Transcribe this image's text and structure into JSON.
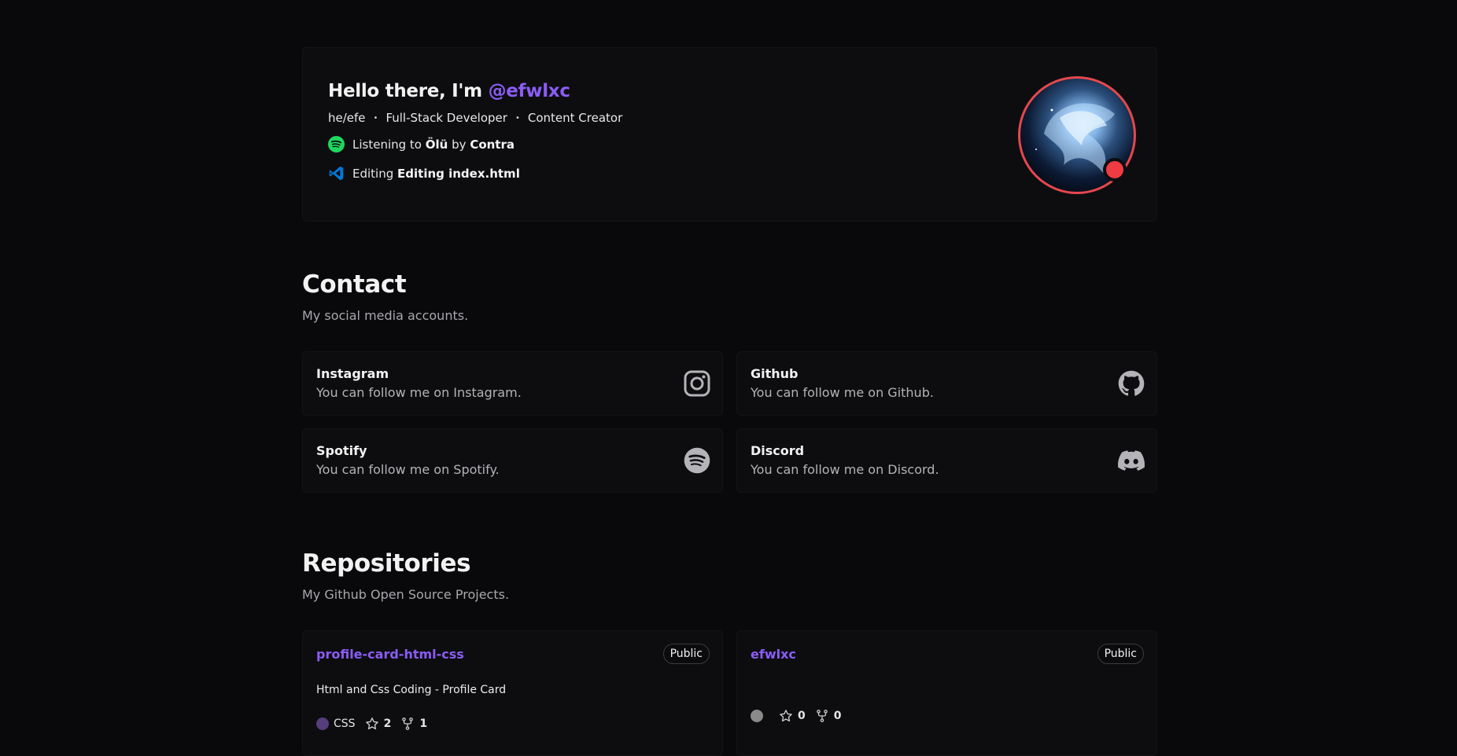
{
  "hero": {
    "greeting": "Hello there, I'm ",
    "handle": "@efwlxc",
    "pronouns": "he/efe",
    "separator": "•",
    "roles": [
      "Full-Stack Developer",
      "Content Creator"
    ],
    "spotify": {
      "prefix": "Listening to",
      "song": "Ölü",
      "by": "by",
      "artist": "Contra"
    },
    "editor": {
      "prefix": "Editing",
      "file": "Editing index.html"
    },
    "status_color": "#ef3b42"
  },
  "contact": {
    "title": "Contact",
    "description": "My social media accounts.",
    "cards": [
      {
        "title": "Instagram",
        "desc": "You can follow me on Instagram.",
        "icon": "instagram-icon"
      },
      {
        "title": "Github",
        "desc": "You can follow me on Github.",
        "icon": "github-icon"
      },
      {
        "title": "Spotify",
        "desc": "You can follow me on Spotify.",
        "icon": "spotify-icon"
      },
      {
        "title": "Discord",
        "desc": "You can follow me on Discord.",
        "icon": "discord-icon"
      }
    ]
  },
  "repos": {
    "title": "Repositories",
    "description": "My Github Open Source Projects.",
    "items": [
      {
        "name": "profile-card-html-css",
        "visibility": "Public",
        "description": "Html and Css Coding - Profile Card",
        "language": "CSS",
        "language_color": "#563d7c",
        "stars": "2",
        "forks": "1"
      },
      {
        "name": "efwlxc",
        "visibility": "Public",
        "description": "",
        "language": "",
        "language_color": "#8a8a8a",
        "stars": "0",
        "forks": "0"
      }
    ]
  },
  "colors": {
    "accent": "#8b5cf6",
    "background": "#09090b",
    "card": "#0d0d10",
    "spotify_green": "#1ed760",
    "vscode_blue": "#0078d4"
  }
}
